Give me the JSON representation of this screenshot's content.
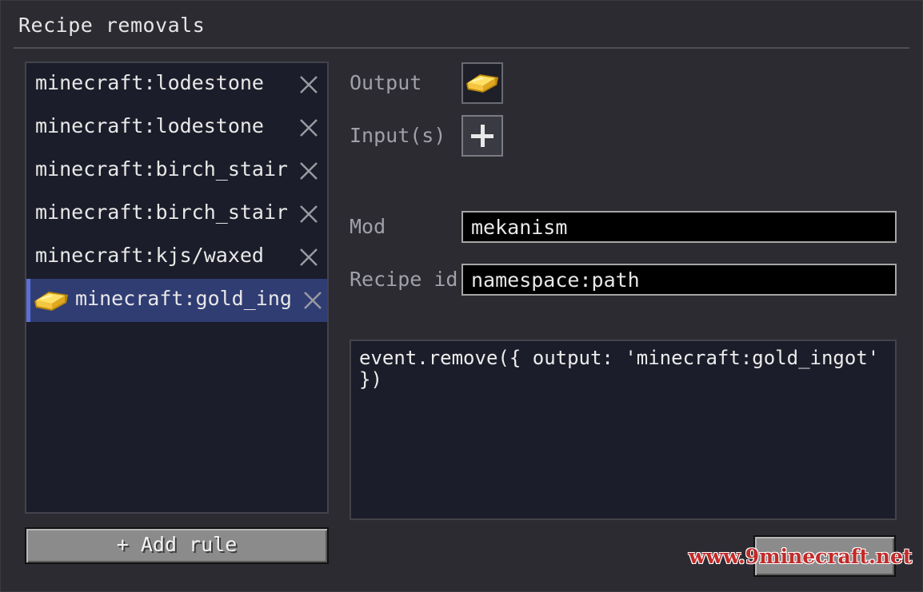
{
  "window": {
    "title": "Recipe removals"
  },
  "rules": {
    "items": [
      {
        "label": "minecraft:lodestone",
        "selected": false
      },
      {
        "label": "minecraft:lodestone",
        "selected": false
      },
      {
        "label": "minecraft:birch_stair",
        "selected": false
      },
      {
        "label": "minecraft:birch_stair",
        "selected": false
      },
      {
        "label": "minecraft:kjs/waxed",
        "selected": false
      },
      {
        "label": "minecraft:gold_ing",
        "selected": true,
        "icon": "gold-ingot-icon"
      }
    ],
    "close_icon": "close-icon",
    "add_button_label": "+ Add rule"
  },
  "form": {
    "output_label": "Output",
    "output_item_icon": "gold-ingot-icon",
    "inputs_label": "Input(s)",
    "inputs_add_icon": "plus-icon",
    "mod_label": "Mod",
    "mod_value": "mekanism",
    "recipe_id_label": "Recipe id",
    "recipe_id_value": "namespace:path"
  },
  "code": {
    "line1": "event.remove({ output: 'minecraft:gold_ingot'",
    "line2": "})"
  },
  "watermark": "www.9minecraft.net",
  "colors": {
    "selected_row": "#303d73",
    "selected_accent": "#5a6fd6",
    "gold": "#f5c542"
  }
}
